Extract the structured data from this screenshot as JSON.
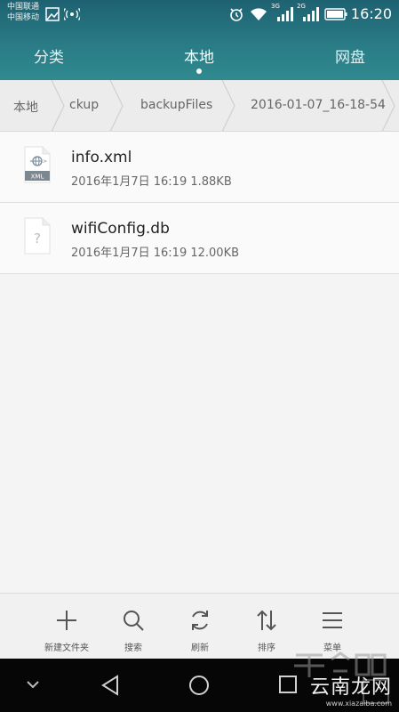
{
  "status_bar": {
    "carrier_1": "中国联通",
    "carrier_2": "中国移动",
    "net_badge_1": "3G",
    "net_badge_2": "2G",
    "time": "16:20"
  },
  "tabs": [
    {
      "label": "分类",
      "active": false
    },
    {
      "label": "本地",
      "active": true
    },
    {
      "label": "网盘",
      "active": false
    }
  ],
  "breadcrumb": [
    "本地",
    "ckup",
    "backupFiles",
    "2016-01-07_16-18-54"
  ],
  "files": [
    {
      "name": "info.xml",
      "meta": "2016年1月7日 16:19 1.88KB",
      "icon": "xml-file-icon",
      "icon_text": "XML"
    },
    {
      "name": "wifiConfig.db",
      "meta": "2016年1月7日 16:19 12.00KB",
      "icon": "unknown-file-icon",
      "icon_text": "?"
    }
  ],
  "toolbar": [
    {
      "label": "新建文件夹",
      "icon": "plus-icon"
    },
    {
      "label": "搜索",
      "icon": "search-icon"
    },
    {
      "label": "刷新",
      "icon": "refresh-icon"
    },
    {
      "label": "排序",
      "icon": "sort-icon"
    },
    {
      "label": "菜单",
      "icon": "menu-icon"
    }
  ],
  "watermark": {
    "big": "云南龙网",
    "small": "www.xiazaiba.com"
  },
  "colors": {
    "header": "#2a7d87",
    "nav": "#060606",
    "background": "#f4f4f4"
  }
}
